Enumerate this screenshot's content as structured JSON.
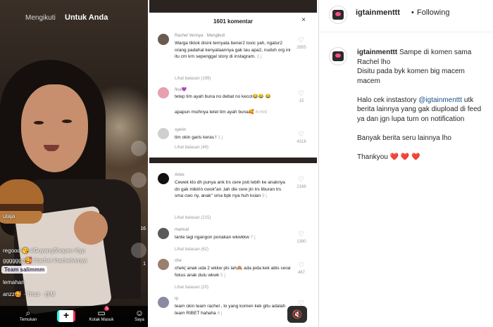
{
  "video": {
    "tab_following": "Mengikuti",
    "tab_foryou": "Untuk Anda",
    "side_counts": [
      "16",
      "1"
    ],
    "creator": "utaja",
    "tags_line1": "regood 😘 #GoyangShopee #fyp",
    "tags_line2": "ggggggg🥰 #rachel #rachelvenya",
    "sticker": "Team salimmm",
    "desc": "lemahan",
    "music": "anzz🥰 · Trhot · @M",
    "nav": {
      "home": "Temukan",
      "inbox": "Kotak Masuk",
      "inbox_badge": "5",
      "profile": "Saya"
    }
  },
  "comments": {
    "count_label": "1601 komentar",
    "close": "×",
    "top_sheet": [
      {
        "name": "Rachel Vennya · Mengikuti",
        "text": "Warga tiktok disini ternyata bener2 toxic yah, ngatur2 orang padahal kenyataannya gak tau apa2, nuduh org ini itu cm krn sepenggal story di instagram.",
        "time": "1 j",
        "replies": "Lihat balasan (199)",
        "likes": "2855",
        "avatar_color": "#6b5b4e"
      },
      {
        "name": "fina💜",
        "text": "tetep tim ayah buna no debat no kecot😂😂 😂",
        "time": "",
        "extra": "apapun msihnya tetet tim ayah buna🥰",
        "extra_time": "4 mnt",
        "replies": "",
        "likes": "15",
        "avatar_color": "#e7a0b0"
      },
      {
        "name": "syerin",
        "text": "tim okin garis keras !",
        "time": "1 j",
        "replies": "Lihat balasan (49)",
        "likes": "4318",
        "avatar_color": "#cfcfcf"
      }
    ],
    "bottom_sheet": [
      {
        "name": "Aries",
        "text": "Cewek klo dh punya ank trs cere psti lebih ke anaknya dn gak mikirin cwok\"an ,lah die cere jin trs liburan trs sma cwo ny, anak\" sma bpk nya huh ksian",
        "time": "9 j",
        "replies": "Lihat balasan (215)",
        "likes": "2166",
        "avatar_color": "#111111"
      },
      {
        "name": "mamud",
        "text": "tante lagi ngangon ponakan wkwkkw",
        "time": "7 j",
        "replies": "Lihat balasan (62)",
        "likes": "1390",
        "avatar_color": "#5a5a5a"
      },
      {
        "name": "che",
        "text": "chek( anak uda 2 wkkw pls lah🙈 ada jeda kek abis cerai fokus anak dulu wkwk",
        "time": "5 j",
        "replies": "Lihat balasan (20)",
        "likes": "467",
        "avatar_color": "#9a7f6e"
      },
      {
        "name": "rp",
        "text": "team okin team rachel , lo yang komen kek gitu adalah team RIBET hahaha",
        "time": "6 j",
        "replies": "",
        "likes": "",
        "avatar_color": "#8a8aa0"
      }
    ],
    "mute_icon": "🔇"
  },
  "instagram": {
    "username": "igtainmenttt",
    "dot": "•",
    "following": "Following",
    "caption_user": "igtainmenttt",
    "caption_first": "Sampe di komen sama Rachel lho",
    "caption_line2": "Disitu pada byk komen big macem macem",
    "caption_p2_before": "Halo cek instastory ",
    "caption_mention": "@igtainmenttt",
    "caption_p2_after": " utk berita lainnya yang gak diupload di feed ya dan jgn lupa turn on notification",
    "caption_p3": "Banyak berita seru lainnya lho",
    "caption_p4": "Thankyou",
    "hearts": "❤️ ❤️ ❤️",
    "colors": {
      "mention": "#1b4f8a",
      "heart": "#d6242b"
    }
  }
}
